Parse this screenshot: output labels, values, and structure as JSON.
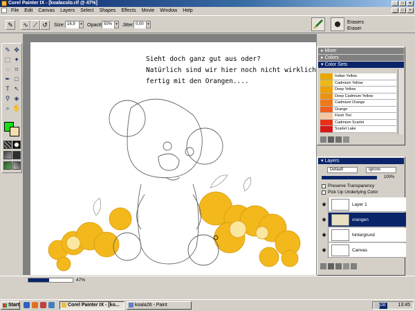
{
  "window": {
    "title": "Corel Painter IX - [koalacolo.rif @ 47%]",
    "min": "_",
    "max": "□",
    "close": "×"
  },
  "menu": [
    "File",
    "Edit",
    "Canvas",
    "Layers",
    "Select",
    "Shapes",
    "Effects",
    "Movie",
    "Window",
    "Help"
  ],
  "propbar": {
    "size_label": "Size:",
    "size_value": "16,9",
    "opacity_label": "Opacity:",
    "opacity_value": "50%",
    "jitter_label": "Jitter:",
    "jitter_value": "0,00"
  },
  "brush": {
    "category": "Erasers",
    "variant": "Eraser"
  },
  "canvas": {
    "note_lines": [
      "Sieht doch ganz gut aus oder?",
      "Natürlich sind wir hier noch nicht wirklich",
      "fertig mit den Orangen...."
    ]
  },
  "status": {
    "zoom": "47%",
    "zoom_fraction": 0.47
  },
  "panels": {
    "mixer": "Mixer",
    "colors": "Colors",
    "color_sets": "Color Sets",
    "color_set_items": [
      {
        "name": "Indian Yellow",
        "color": "#e8a800"
      },
      {
        "name": "Cadmium Yellow",
        "color": "#f0b810"
      },
      {
        "name": "Deep Yellow",
        "color": "#f0a000"
      },
      {
        "name": "Deep Cadmium Yellow",
        "color": "#f09010"
      },
      {
        "name": "Cadmium Orange",
        "color": "#f07818"
      },
      {
        "name": "Orange",
        "color": "#f06020"
      },
      {
        "name": "Flesh Tint",
        "color": "#f4c8a0"
      },
      {
        "name": "Cadmium Scarlet",
        "color": "#e83018"
      },
      {
        "name": "Scarlet Lake",
        "color": "#d81818"
      }
    ],
    "layers": {
      "title": "Layers",
      "composite": "Default",
      "method": "Ignore",
      "opacity": "100%",
      "preserve_transparency": "Preserve Transparency",
      "pick_up_color": "Pick Up Underlying Color",
      "items": [
        {
          "name": "Layer 1",
          "selected": false
        },
        {
          "name": "orangen",
          "selected": true
        },
        {
          "name": "hintergrund",
          "selected": false
        },
        {
          "name": "Canvas",
          "selected": false
        }
      ]
    }
  },
  "taskbar": {
    "start": "Start",
    "tasks": [
      {
        "label": "Corel Painter IX - [ko...",
        "active": true
      },
      {
        "label": "koala26 - Paint",
        "active": false
      }
    ],
    "language": "DE",
    "clock": "13:45"
  },
  "colors": {
    "primary": "#19e119",
    "secondary": "#f4deb0",
    "title_active": "#0a246a",
    "orange_fruit": "#f2b81c"
  }
}
